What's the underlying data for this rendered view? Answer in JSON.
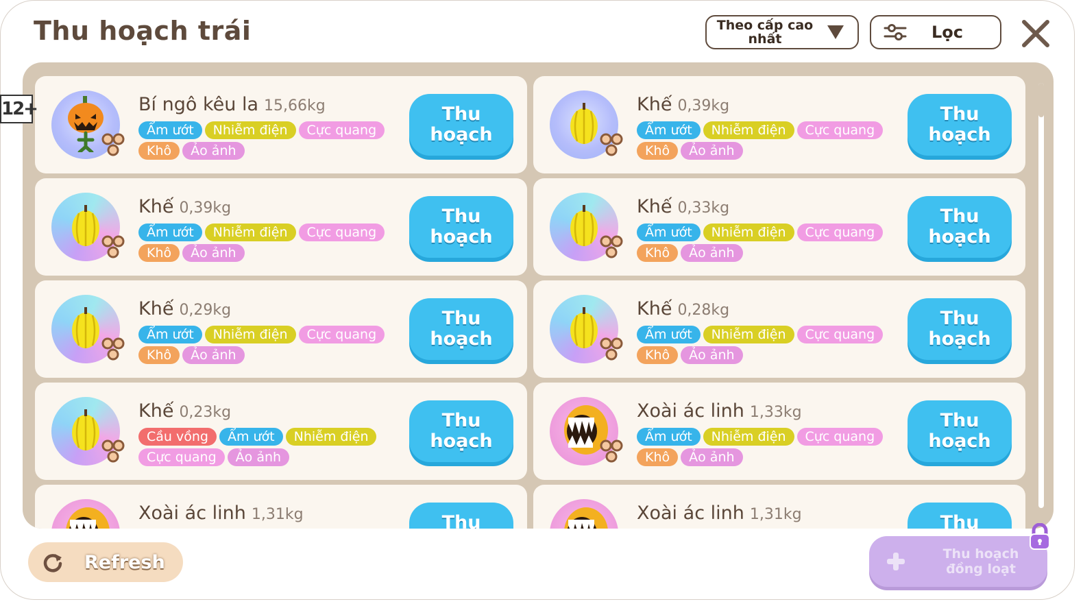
{
  "title": "Thu hoạch trái",
  "sort": {
    "label": "Theo cấp cao nhất"
  },
  "filter": {
    "label": "Lọc"
  },
  "age_rating": "12+",
  "harvest_label_line1": "Thu",
  "harvest_label_line2": "hoạch",
  "fruits": [
    {
      "name": "Bí ngô kêu la",
      "weight": "15,66kg",
      "icon": "screaming-pumpkin-icon",
      "bg": "blue",
      "tags": [
        {
          "label": "Ẩm ướt",
          "kind": "amuot"
        },
        {
          "label": "Nhiễm điện",
          "kind": "nhiemdien"
        },
        {
          "label": "Cực quang",
          "kind": "cucquang"
        },
        {
          "label": "Khô",
          "kind": "kho"
        },
        {
          "label": "Ảo ảnh",
          "kind": "aoanh"
        }
      ]
    },
    {
      "name": "Khế",
      "weight": "0,39kg",
      "icon": "starfruit-icon",
      "bg": "blue",
      "tags": [
        {
          "label": "Ẩm ướt",
          "kind": "amuot"
        },
        {
          "label": "Nhiễm điện",
          "kind": "nhiemdien"
        },
        {
          "label": "Cực quang",
          "kind": "cucquang"
        },
        {
          "label": "Khô",
          "kind": "kho"
        },
        {
          "label": "Ảo ảnh",
          "kind": "aoanh"
        }
      ]
    },
    {
      "name": "Khế",
      "weight": "0,39kg",
      "icon": "starfruit-icon",
      "bg": "rainbow",
      "tags": [
        {
          "label": "Ẩm ướt",
          "kind": "amuot"
        },
        {
          "label": "Nhiễm điện",
          "kind": "nhiemdien"
        },
        {
          "label": "Cực quang",
          "kind": "cucquang"
        },
        {
          "label": "Khô",
          "kind": "kho"
        },
        {
          "label": "Ảo ảnh",
          "kind": "aoanh"
        }
      ]
    },
    {
      "name": "Khế",
      "weight": "0,33kg",
      "icon": "starfruit-icon",
      "bg": "rainbow",
      "tags": [
        {
          "label": "Ẩm ướt",
          "kind": "amuot"
        },
        {
          "label": "Nhiễm điện",
          "kind": "nhiemdien"
        },
        {
          "label": "Cực quang",
          "kind": "cucquang"
        },
        {
          "label": "Khô",
          "kind": "kho"
        },
        {
          "label": "Ảo ảnh",
          "kind": "aoanh"
        }
      ]
    },
    {
      "name": "Khế",
      "weight": "0,29kg",
      "icon": "starfruit-icon",
      "bg": "rainbow",
      "tags": [
        {
          "label": "Ẩm ướt",
          "kind": "amuot"
        },
        {
          "label": "Nhiễm điện",
          "kind": "nhiemdien"
        },
        {
          "label": "Cực quang",
          "kind": "cucquang"
        },
        {
          "label": "Khô",
          "kind": "kho"
        },
        {
          "label": "Ảo ảnh",
          "kind": "aoanh"
        }
      ]
    },
    {
      "name": "Khế",
      "weight": "0,28kg",
      "icon": "starfruit-icon",
      "bg": "rainbow",
      "tags": [
        {
          "label": "Ẩm ướt",
          "kind": "amuot"
        },
        {
          "label": "Nhiễm điện",
          "kind": "nhiemdien"
        },
        {
          "label": "Cực quang",
          "kind": "cucquang"
        },
        {
          "label": "Khô",
          "kind": "kho"
        },
        {
          "label": "Ảo ảnh",
          "kind": "aoanh"
        }
      ]
    },
    {
      "name": "Khế",
      "weight": "0,23kg",
      "icon": "starfruit-icon",
      "bg": "rainbow",
      "tags": [
        {
          "label": "Cầu vồng",
          "kind": "cauvong"
        },
        {
          "label": "Ẩm ướt",
          "kind": "amuot"
        },
        {
          "label": "Nhiễm điện",
          "kind": "nhiemdien"
        },
        {
          "label": "Cực quang",
          "kind": "cucquang"
        },
        {
          "label": "Ảo ảnh",
          "kind": "aoanh"
        }
      ]
    },
    {
      "name": "Xoài ác linh",
      "weight": "1,33kg",
      "icon": "evil-mango-icon",
      "bg": "pink",
      "tags": [
        {
          "label": "Ẩm ướt",
          "kind": "amuot"
        },
        {
          "label": "Nhiễm điện",
          "kind": "nhiemdien"
        },
        {
          "label": "Cực quang",
          "kind": "cucquang"
        },
        {
          "label": "Khô",
          "kind": "kho"
        },
        {
          "label": "Ảo ảnh",
          "kind": "aoanh"
        }
      ]
    },
    {
      "name": "Xoài ác linh",
      "weight": "1,31kg",
      "icon": "evil-mango-icon",
      "bg": "pink",
      "tags": []
    },
    {
      "name": "Xoài ác linh",
      "weight": "1,31kg",
      "icon": "evil-mango-icon",
      "bg": "pink",
      "tags": []
    }
  ],
  "refresh": {
    "label": "Refresh"
  },
  "bulk_harvest": {
    "label": "Thu hoạch đồng loạt",
    "locked": true
  },
  "colors": {
    "harvest_button": "#3fc0f0",
    "title": "#5e4a3c",
    "panel": "#d5c7b4",
    "bulk": "#cdb0ec"
  }
}
